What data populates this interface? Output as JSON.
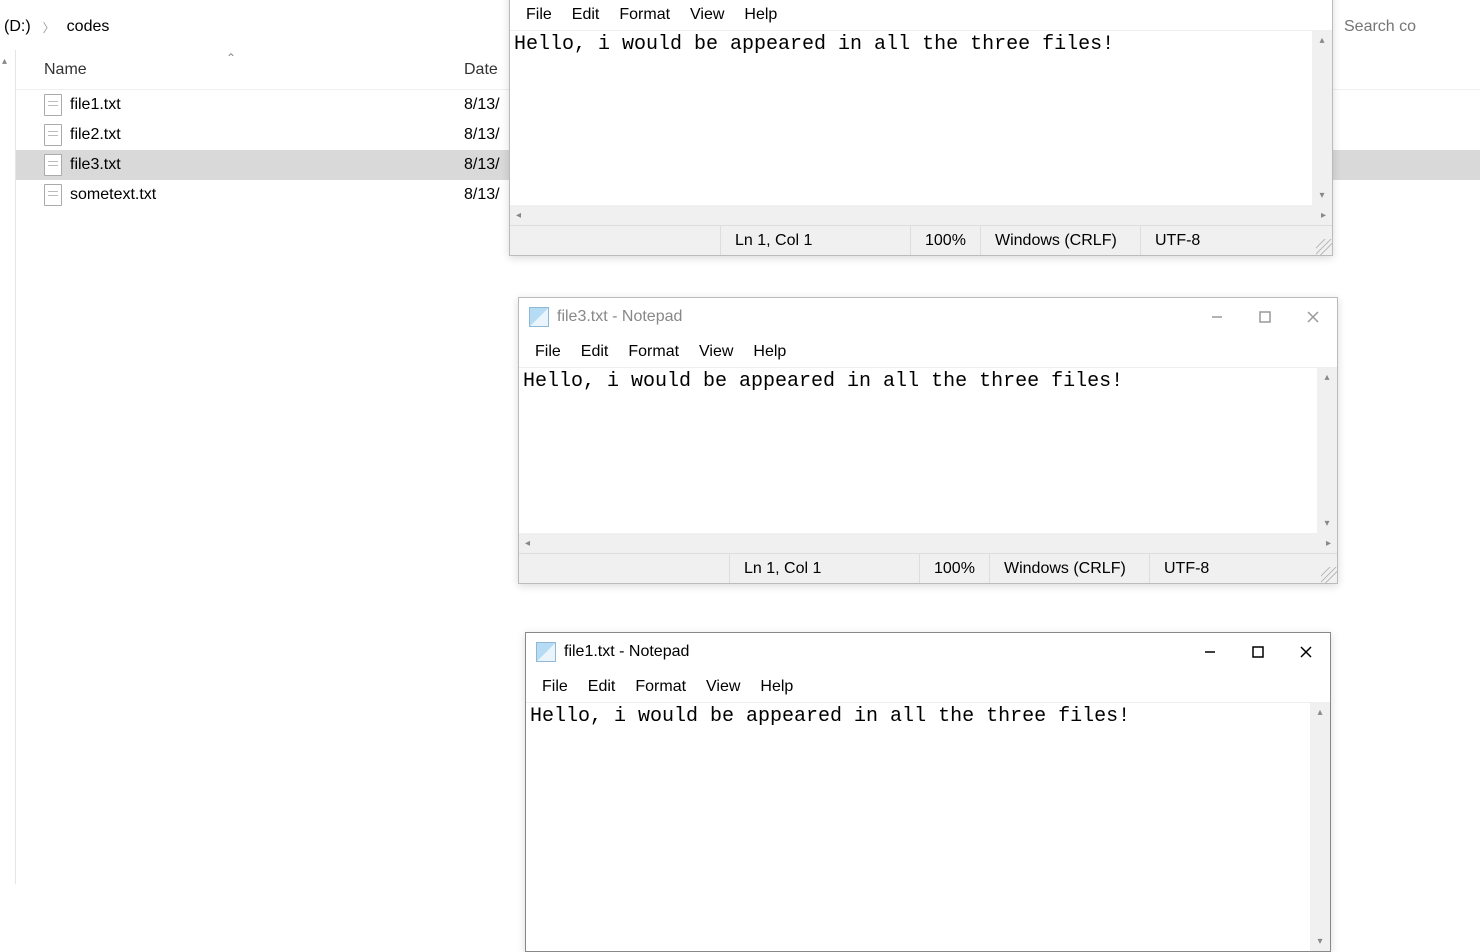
{
  "explorer": {
    "drive_label": "(D:)",
    "folder": "codes",
    "search_placeholder": "Search co",
    "col_name": "Name",
    "col_date": "Date",
    "files": [
      {
        "name": "file1.txt",
        "date": "8/13/",
        "selected": false
      },
      {
        "name": "file2.txt",
        "date": "8/13/",
        "selected": false
      },
      {
        "name": "file3.txt",
        "date": "8/13/",
        "selected": true
      },
      {
        "name": "sometext.txt",
        "date": "8/13/",
        "selected": false
      }
    ]
  },
  "menus": {
    "file": "File",
    "edit": "Edit",
    "format": "Format",
    "view": "View",
    "help": "Help"
  },
  "status": {
    "pos": "Ln 1, Col 1",
    "zoom": "100%",
    "eol": "Windows (CRLF)",
    "enc": "UTF-8"
  },
  "notepad1": {
    "content": "Hello, i would be appeared in all the three files!"
  },
  "notepad2": {
    "title": "file3.txt - Notepad",
    "content": "Hello, i would be appeared in all the three files!"
  },
  "notepad3": {
    "title": "file1.txt - Notepad",
    "content": "Hello, i would be appeared in all the three files!"
  }
}
